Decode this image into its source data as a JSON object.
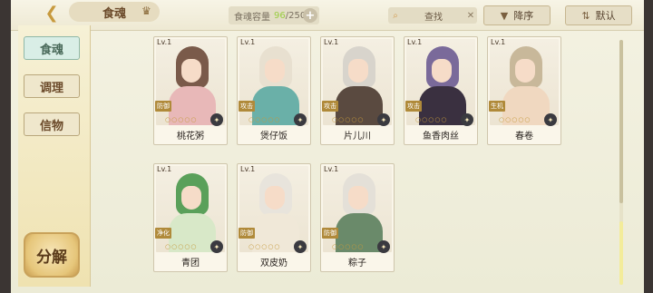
{
  "header": {
    "title": "食魂",
    "capacity_label": "食魂容量",
    "capacity_current": "96",
    "capacity_total": "250",
    "search_placeholder": "查找",
    "sort_order_label": "降序",
    "sort_mode_label": "默认"
  },
  "sidebar": {
    "tabs": [
      {
        "label": "食魂",
        "active": true
      },
      {
        "label": "调理",
        "active": false
      },
      {
        "label": "信物",
        "active": false
      }
    ],
    "decompose_label": "分解"
  },
  "cards": [
    {
      "level": "Lv.1",
      "name": "桃花粥",
      "tag": "防御",
      "tag_color": "#b08a3a",
      "hair": "#7a5a4a",
      "body": "#e8b8b8"
    },
    {
      "level": "Lv.1",
      "name": "煲仔饭",
      "tag": "攻击",
      "tag_color": "#b08a3a",
      "hair": "#e8e0d0",
      "body": "#6ab0a8"
    },
    {
      "level": "Lv.1",
      "name": "片儿川",
      "tag": "攻击",
      "tag_color": "#b08a3a",
      "hair": "#d8d4cc",
      "body": "#5a4a40"
    },
    {
      "level": "Lv.1",
      "name": "鱼香肉丝",
      "tag": "攻击",
      "tag_color": "#b08a3a",
      "hair": "#7a6a9a",
      "body": "#3a3040"
    },
    {
      "level": "Lv.1",
      "name": "春卷",
      "tag": "生机",
      "tag_color": "#b08a3a",
      "hair": "#c8b89a",
      "body": "#f0d8c0"
    },
    {
      "level": "Lv.1",
      "name": "青团",
      "tag": "净化",
      "tag_color": "#b08a3a",
      "hair": "#5aa05a",
      "body": "#d8e8c8"
    },
    {
      "level": "Lv.1",
      "name": "双皮奶",
      "tag": "防御",
      "tag_color": "#b08a3a",
      "hair": "#e8e4dc",
      "body": "#f0e8d8"
    },
    {
      "level": "Lv.1",
      "name": "粽子",
      "tag": "防御",
      "tag_color": "#b08a3a",
      "hair": "#e4e0d8",
      "body": "#6a8a6a"
    }
  ],
  "star_glyphs": "○○○○○"
}
